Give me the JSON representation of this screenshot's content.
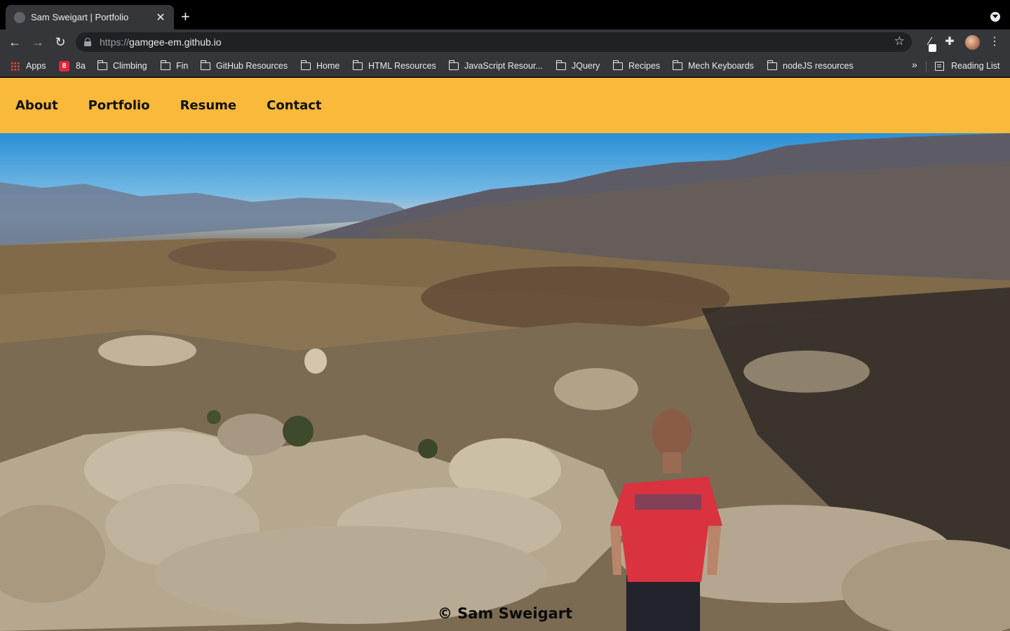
{
  "browser": {
    "tab": {
      "title": "Sam Sweigart | Portfolio"
    },
    "url": {
      "scheme": "https://",
      "host": "gamgee-em.github.io"
    },
    "bookmarks": [
      {
        "label": "Apps",
        "icon": "apps-grid-icon"
      },
      {
        "label": "8a",
        "icon": "8a-logo-icon"
      },
      {
        "label": "Climbing",
        "icon": "folder-icon"
      },
      {
        "label": "Fin",
        "icon": "folder-icon"
      },
      {
        "label": "GitHub Resources",
        "icon": "folder-icon"
      },
      {
        "label": "Home",
        "icon": "folder-icon"
      },
      {
        "label": "HTML Resources",
        "icon": "folder-icon"
      },
      {
        "label": "JavaScript Resour...",
        "icon": "folder-icon"
      },
      {
        "label": "JQuery",
        "icon": "folder-icon"
      },
      {
        "label": "Recipes",
        "icon": "folder-icon"
      },
      {
        "label": "Mech Keyboards",
        "icon": "folder-icon"
      },
      {
        "label": "nodeJS resources",
        "icon": "folder-icon"
      }
    ],
    "reading_list": "Reading List"
  },
  "site": {
    "nav": [
      {
        "label": "About"
      },
      {
        "label": "Portfolio"
      },
      {
        "label": "Resume"
      },
      {
        "label": "Contact"
      }
    ],
    "footer": "© Sam Sweigart",
    "accent": "#f9b93a"
  }
}
